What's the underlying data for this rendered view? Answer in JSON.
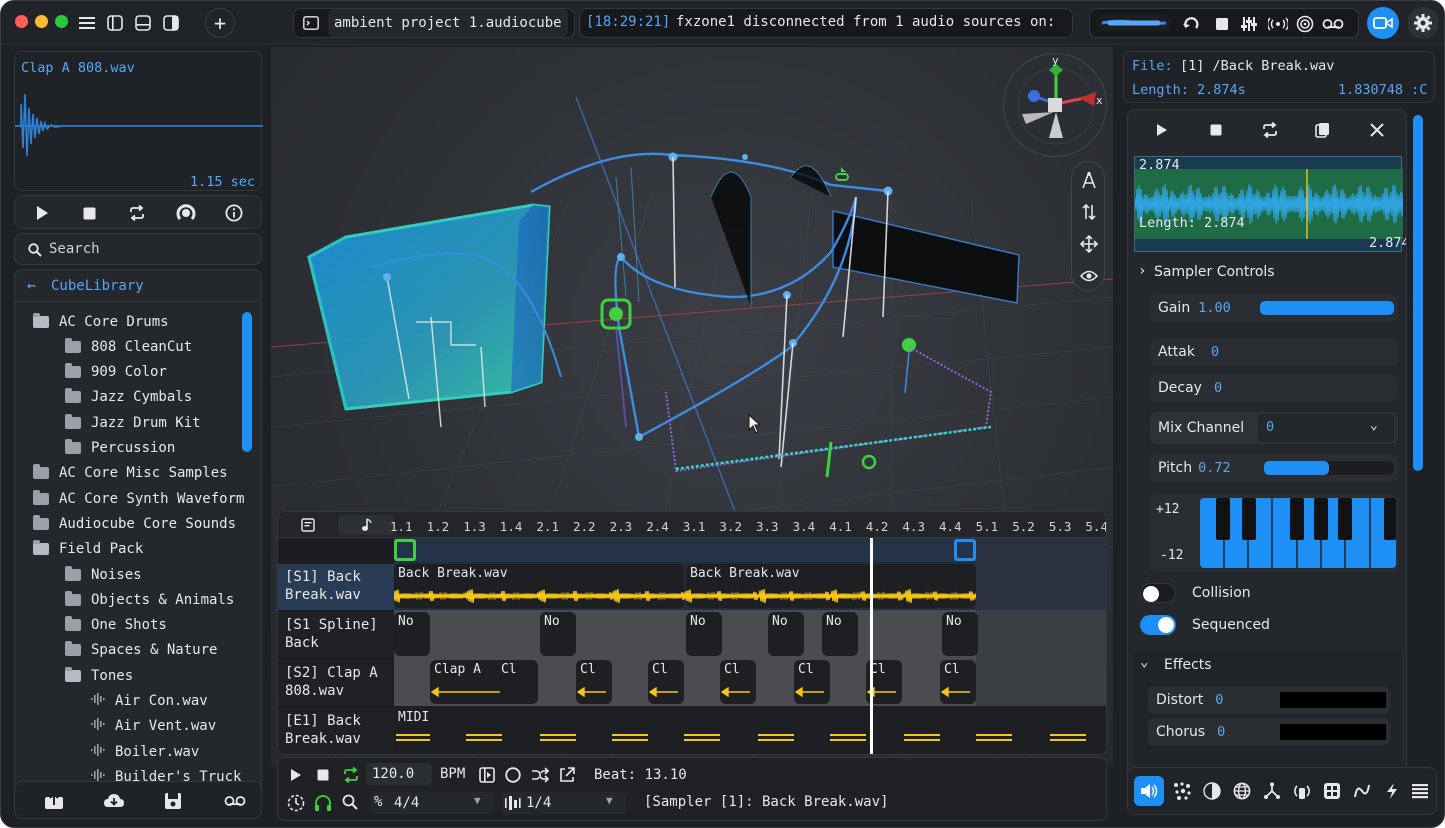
{
  "titlebar": {
    "project_name": "ambient project 1.audiocube",
    "console_time": "[18:29:21]",
    "console_message": "fxzone1 disconnected from 1 audio sources on:"
  },
  "preview": {
    "filename": "Clap A 808.wav",
    "duration": "1.15 sec"
  },
  "search": {
    "placeholder": "Search"
  },
  "library": {
    "back_label": "CubeLibrary",
    "items": [
      {
        "label": "AC Core Drums",
        "indent": 0,
        "kind": "folder-open"
      },
      {
        "label": "808 CleanCut",
        "indent": 1,
        "kind": "folder"
      },
      {
        "label": "909 Color",
        "indent": 1,
        "kind": "folder"
      },
      {
        "label": "Jazz Cymbals",
        "indent": 1,
        "kind": "folder"
      },
      {
        "label": "Jazz Drum Kit",
        "indent": 1,
        "kind": "folder"
      },
      {
        "label": "Percussion",
        "indent": 1,
        "kind": "folder"
      },
      {
        "label": "AC Core Misc Samples",
        "indent": 0,
        "kind": "folder"
      },
      {
        "label": "AC Core Synth Waveform",
        "indent": 0,
        "kind": "folder"
      },
      {
        "label": "Audiocube Core Sounds",
        "indent": 0,
        "kind": "folder"
      },
      {
        "label": "Field Pack",
        "indent": 0,
        "kind": "folder-open"
      },
      {
        "label": "Noises",
        "indent": 1,
        "kind": "folder"
      },
      {
        "label": "Objects & Animals",
        "indent": 1,
        "kind": "folder"
      },
      {
        "label": "One Shots",
        "indent": 1,
        "kind": "folder"
      },
      {
        "label": "Spaces & Nature",
        "indent": 1,
        "kind": "folder"
      },
      {
        "label": "Tones",
        "indent": 1,
        "kind": "folder-open"
      },
      {
        "label": "Air Con.wav",
        "indent": 2,
        "kind": "file"
      },
      {
        "label": "Air Vent.wav",
        "indent": 2,
        "kind": "file"
      },
      {
        "label": "Boiler.wav",
        "indent": 2,
        "kind": "file"
      },
      {
        "label": "Builder's Truck",
        "indent": 2,
        "kind": "file"
      }
    ]
  },
  "gizmo": {
    "x": "x",
    "y": "y"
  },
  "sequencer": {
    "ruler": [
      "1.1",
      "1.2",
      "1.3",
      "1.4",
      "2.1",
      "2.2",
      "2.3",
      "2.4",
      "3.1",
      "3.2",
      "3.3",
      "3.4",
      "4.1",
      "4.2",
      "4.3",
      "4.4",
      "5.1",
      "5.2",
      "5.3",
      "5.4"
    ],
    "tracks": [
      {
        "label": "[S1] Back Break.wav",
        "clips": [
          "Back Break.wav",
          "Back Break.wav"
        ]
      },
      {
        "label": "[S1 Spline] Back",
        "clips": [
          "No",
          "No",
          "No",
          "No",
          "No",
          "No"
        ]
      },
      {
        "label": "[S2] Clap A 808.wav",
        "clips": [
          "Clap A",
          "Cl",
          "Cl",
          "Cl",
          "Cl",
          "Cl",
          "Cl",
          "Cl"
        ]
      },
      {
        "label": "[E1] Back Break.wav",
        "clips": [
          "MIDI"
        ]
      }
    ]
  },
  "transport": {
    "bpm_value": "120.0",
    "bpm_label": "BPM",
    "beat": "Beat: 13.10",
    "time_sig": "4/4",
    "quantize": "1/4",
    "status": "[Sampler [1]: Back Break.wav]"
  },
  "inspector": {
    "file_label": "File:",
    "file_value": "[1] /Back Break.wav",
    "length": "Length: 2.874s",
    "coord": "1.830748 :C",
    "wave_top": "2.874",
    "wave_length": "Length: 2.874",
    "wave_bottom": "2.874",
    "sampler_title": "Sampler Controls",
    "gain_label": "Gain",
    "gain_value": "1.00",
    "gain_level": 1.0,
    "attack_label": "Attak",
    "attack_value": "0",
    "decay_label": "Decay",
    "decay_value": "0",
    "mix_label": "Mix Channel",
    "mix_value": "0",
    "pitch_label": "Pitch",
    "pitch_value": "0.72",
    "pitch_level": 0.5,
    "oct_up": "+12",
    "oct_down": "-12",
    "collision_label": "Collision",
    "collision_on": false,
    "sequenced_label": "Sequenced",
    "sequenced_on": true,
    "effects_title": "Effects",
    "distort_label": "Distort",
    "distort_value": "0",
    "chorus_label": "Chorus",
    "chorus_value": "0"
  },
  "colors": {
    "accent": "#1e8ff5",
    "accent_text": "#58a6f5",
    "waveform_yellow": "#f5c518",
    "green": "#3fd13f",
    "panel": "#24272c"
  }
}
